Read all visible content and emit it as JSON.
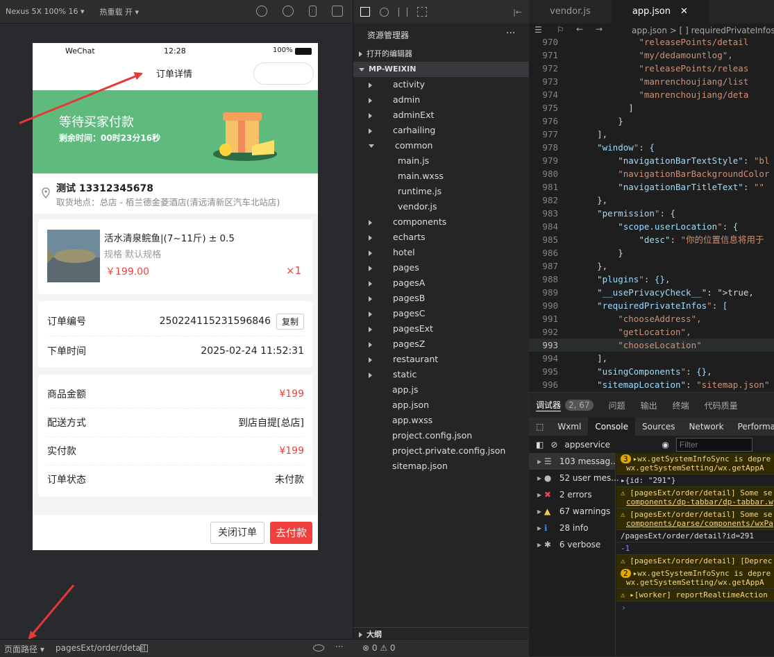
{
  "sim_toolbar": {
    "device": "Nexus 5X 100% 16 ▾",
    "hot_reload": "热重载 开 ▾"
  },
  "phone": {
    "status": {
      "carrier": "WeChat",
      "time": "12:28",
      "battery": "100%"
    },
    "nav_title": "订单详情",
    "banner": {
      "title": "等待买家付款",
      "subtitle": "剩余时间：00时23分16秒"
    },
    "address": {
      "name_phone": "测试 13312345678",
      "detail": "取货地点：总店 - 栢兰德金菱酒店(清远清新区汽车北站店)"
    },
    "product": {
      "name": "活水清泉鲩鱼|(7~11斤) ± 0.5",
      "spec": "规格 默认规格",
      "price": "￥199.00",
      "qty": "×1"
    },
    "order_info": {
      "no_label": "订单编号",
      "no_value": "250224115231596846",
      "copy_btn": "复制",
      "time_label": "下单时间",
      "time_value": "2025-02-24 11:52:31"
    },
    "fees": [
      {
        "label": "商品金额",
        "value": "¥199",
        "red": true
      },
      {
        "label": "配送方式",
        "value": "到店自提[总店]",
        "red": false
      },
      {
        "label": "实付款",
        "value": "¥199",
        "red": true
      },
      {
        "label": "订单状态",
        "value": "未付款",
        "red": false
      }
    ],
    "buttons": {
      "close": "关闭订单",
      "pay": "去付款"
    },
    "accent": "#f0403c",
    "banner_color": "#5fba7e"
  },
  "explorer": {
    "title": "资源管理器",
    "more": "···",
    "open_editors": "打开的编辑器",
    "project": "MP-WEIXIN",
    "tree": [
      {
        "label": "activity",
        "type": "folder",
        "indent": 1
      },
      {
        "label": "admin",
        "type": "folder",
        "indent": 1
      },
      {
        "label": "adminExt",
        "type": "folder",
        "indent": 1
      },
      {
        "label": "carhailing",
        "type": "folder",
        "indent": 1
      },
      {
        "label": "common",
        "type": "folder-open",
        "indent": 1
      },
      {
        "label": "main.js",
        "type": "file",
        "indent": 2
      },
      {
        "label": "main.wxss",
        "type": "file",
        "indent": 2
      },
      {
        "label": "runtime.js",
        "type": "file",
        "indent": 2
      },
      {
        "label": "vendor.js",
        "type": "file",
        "indent": 2
      },
      {
        "label": "components",
        "type": "folder",
        "indent": 1
      },
      {
        "label": "echarts",
        "type": "folder",
        "indent": 1
      },
      {
        "label": "hotel",
        "type": "folder",
        "indent": 1
      },
      {
        "label": "pages",
        "type": "folder",
        "indent": 1
      },
      {
        "label": "pagesA",
        "type": "folder",
        "indent": 1
      },
      {
        "label": "pagesB",
        "type": "folder",
        "indent": 1
      },
      {
        "label": "pagesC",
        "type": "folder",
        "indent": 1
      },
      {
        "label": "pagesExt",
        "type": "folder",
        "indent": 1
      },
      {
        "label": "pagesZ",
        "type": "folder",
        "indent": 1
      },
      {
        "label": "restaurant",
        "type": "folder",
        "indent": 1
      },
      {
        "label": "static",
        "type": "folder",
        "indent": 1
      },
      {
        "label": "app.js",
        "type": "file",
        "indent": 1
      },
      {
        "label": "app.json",
        "type": "file",
        "indent": 1
      },
      {
        "label": "app.wxss",
        "type": "file",
        "indent": 1
      },
      {
        "label": "project.config.json",
        "type": "file",
        "indent": 1
      },
      {
        "label": "project.private.config.json",
        "type": "file",
        "indent": 1
      },
      {
        "label": "sitemap.json",
        "type": "file",
        "indent": 1
      }
    ],
    "outline": "大纲"
  },
  "editor": {
    "tabs": [
      "vendor.js",
      "app.json"
    ],
    "breadcrumb": "app.json > [ ] requiredPrivateInfos",
    "lines": [
      {
        "n": "970",
        "t": "            \"releasePoints/detail"
      },
      {
        "n": "971",
        "t": "            \"my/dedamountlog\","
      },
      {
        "n": "972",
        "t": "            \"releasePoints/releas"
      },
      {
        "n": "973",
        "t": "            \"manrenchoujiang/list"
      },
      {
        "n": "974",
        "t": "            \"manrenchoujiang/deta"
      },
      {
        "n": "975",
        "t": "          ]"
      },
      {
        "n": "976",
        "t": "        }"
      },
      {
        "n": "977",
        "t": "    ],"
      },
      {
        "n": "978",
        "t": "    \"window\": {"
      },
      {
        "n": "979",
        "t": "        \"navigationBarTextStyle\": \"bl"
      },
      {
        "n": "980",
        "t": "        \"navigationBarBackgroundColor"
      },
      {
        "n": "981",
        "t": "        \"navigationBarTitleText\": \"\""
      },
      {
        "n": "982",
        "t": "    },"
      },
      {
        "n": "983",
        "t": "    \"permission\": {"
      },
      {
        "n": "984",
        "t": "        \"scope.userLocation\": {"
      },
      {
        "n": "985",
        "t": "            \"desc\": \"你的位置信息将用于"
      },
      {
        "n": "986",
        "t": "        }"
      },
      {
        "n": "987",
        "t": "    },"
      },
      {
        "n": "988",
        "t": "    \"plugins\": {},"
      },
      {
        "n": "989",
        "t": "    \"__usePrivacyCheck__\": true,"
      },
      {
        "n": "990",
        "t": "    \"requiredPrivateInfos\": ["
      },
      {
        "n": "991",
        "t": "        \"chooseAddress\","
      },
      {
        "n": "992",
        "t": "        \"getLocation\","
      },
      {
        "n": "993",
        "t": "        \"chooseLocation\""
      },
      {
        "n": "994",
        "t": "    ],"
      },
      {
        "n": "995",
        "t": "    \"usingComponents\": {},"
      },
      {
        "n": "996",
        "t": "    \"sitemapLocation\": \"sitemap.json\""
      }
    ]
  },
  "debug": {
    "tabs": [
      "调试器",
      "2, 67",
      "问题",
      "输出",
      "终端",
      "代码质量"
    ],
    "console_tabs": [
      "Wxml",
      "Console",
      "Sources",
      "Network",
      "Performa"
    ],
    "context": "appservice",
    "filter_placeholder": "Filter",
    "categories": [
      "103 messag...",
      "52 user mes...",
      "2 errors",
      "67 warnings",
      "28 info",
      "6 verbose"
    ],
    "messages": [
      {
        "text": "▸wx.getSystemInfoSync is depre",
        "text2": "wx.getSystemSetting/wx.getAppA",
        "type": "warn",
        "badge": "3"
      },
      {
        "text": "  ▸{id: \"291\"}",
        "type": "log"
      },
      {
        "text": "[pagesExt/order/detail] Some se",
        "text2": "components/dp-tabbar/dp-tabbar.w",
        "type": "warn"
      },
      {
        "text": "[pagesExt/order/detail] Some se",
        "text2": "components/parse/components/wxPa",
        "type": "warn"
      },
      {
        "text": "/pagesExt/order/detail?id=291",
        "type": "log"
      },
      {
        "text": "-1",
        "type": "num"
      },
      {
        "text": "[pagesExt/order/detail] [Deprec",
        "type": "warn"
      },
      {
        "text": "▸wx.getSystemInfoSync is depre",
        "text2": "wx.getSystemSetting/wx.getAppA",
        "type": "warn",
        "badge": "2"
      },
      {
        "text": "▸[worker] reportRealtimeAction",
        "type": "warn"
      }
    ]
  },
  "statusbar": {
    "path_label": "页面路径 ▾",
    "path": "pagesExt/order/detail",
    "problems": "⊗ 0 ⚠ 0"
  }
}
